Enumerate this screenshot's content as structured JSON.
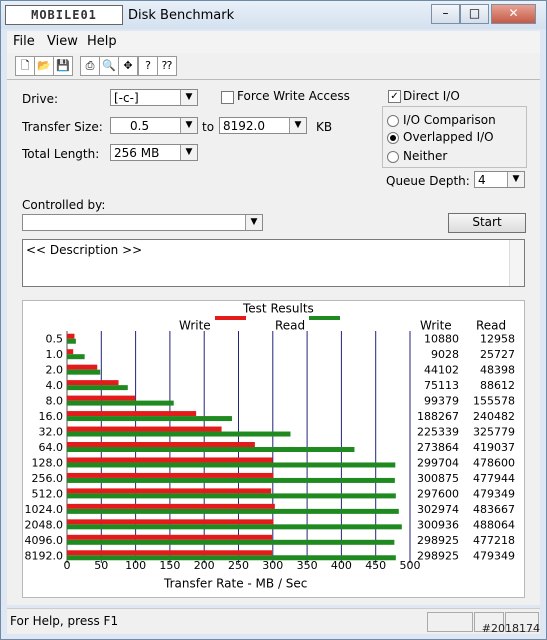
{
  "window": {
    "logo_text": "MOBILE01",
    "title": "Disk Benchmark",
    "buttons": {
      "minimize": "–",
      "maximize": "□",
      "close": "✕"
    }
  },
  "menu": [
    {
      "label": "File"
    },
    {
      "label": "View"
    },
    {
      "label": "Help"
    }
  ],
  "toolbar": [
    {
      "name": "new-icon",
      "glyph": "🗋"
    },
    {
      "name": "open-icon",
      "glyph": "📂"
    },
    {
      "name": "save-icon",
      "glyph": "💾"
    },
    {
      "name": "print-icon",
      "glyph": "⎙"
    },
    {
      "name": "zoom-icon",
      "glyph": "🔍"
    },
    {
      "name": "move-icon",
      "glyph": "✥"
    },
    {
      "name": "help-icon",
      "glyph": "?"
    },
    {
      "name": "context-help-icon",
      "glyph": "⁇"
    }
  ],
  "form": {
    "drive_label": "Drive:",
    "drive_value": "[-c-]",
    "force_write_label": "Force Write Access",
    "direct_io_label": "Direct I/O",
    "transfer_size_label": "Transfer Size:",
    "transfer_from": "0.5",
    "to_label": "to",
    "transfer_to": "8192.0",
    "kb_label": "KB",
    "total_length_label": "Total Length:",
    "total_length_value": "256 MB",
    "io_comparison_label": "I/O Comparison",
    "overlapped_io_label": "Overlapped I/O",
    "neither_label": "Neither",
    "queue_depth_label": "Queue Depth:",
    "queue_depth_value": "4",
    "controlled_by_label": "Controlled by:",
    "controlled_by_value": "",
    "start_label": "Start",
    "description": "<< Description >>"
  },
  "results": {
    "title": "Test Results",
    "legend_write": "Write",
    "legend_read": "Read",
    "col_write": "Write",
    "col_read": "Read",
    "xlabel": "Transfer Rate - MB / Sec",
    "write_color": "#e31b1b",
    "read_color": "#1f8a1f"
  },
  "chart_data": {
    "type": "bar",
    "orientation": "horizontal",
    "xlim": [
      0,
      500
    ],
    "x_ticks": [
      0,
      50,
      100,
      150,
      200,
      250,
      300,
      350,
      400,
      450,
      500
    ],
    "categories": [
      "0.5",
      "1.0",
      "2.0",
      "4.0",
      "8.0",
      "16.0",
      "32.0",
      "64.0",
      "128.0",
      "256.0",
      "512.0",
      "1024.0",
      "2048.0",
      "4096.0",
      "8192.0"
    ],
    "series": [
      {
        "name": "Write",
        "values": [
          10880,
          9028,
          44102,
          75113,
          99379,
          188267,
          225339,
          273864,
          299704,
          300875,
          297600,
          302974,
          300936,
          298925,
          298925
        ]
      },
      {
        "name": "Read",
        "values": [
          12958,
          25727,
          48398,
          88612,
          155578,
          240482,
          325779,
          419037,
          478600,
          477944,
          479349,
          483667,
          488064,
          477218,
          479349
        ]
      }
    ]
  },
  "status": {
    "help_text": "For Help, press F1",
    "watermark": "#2018174"
  }
}
